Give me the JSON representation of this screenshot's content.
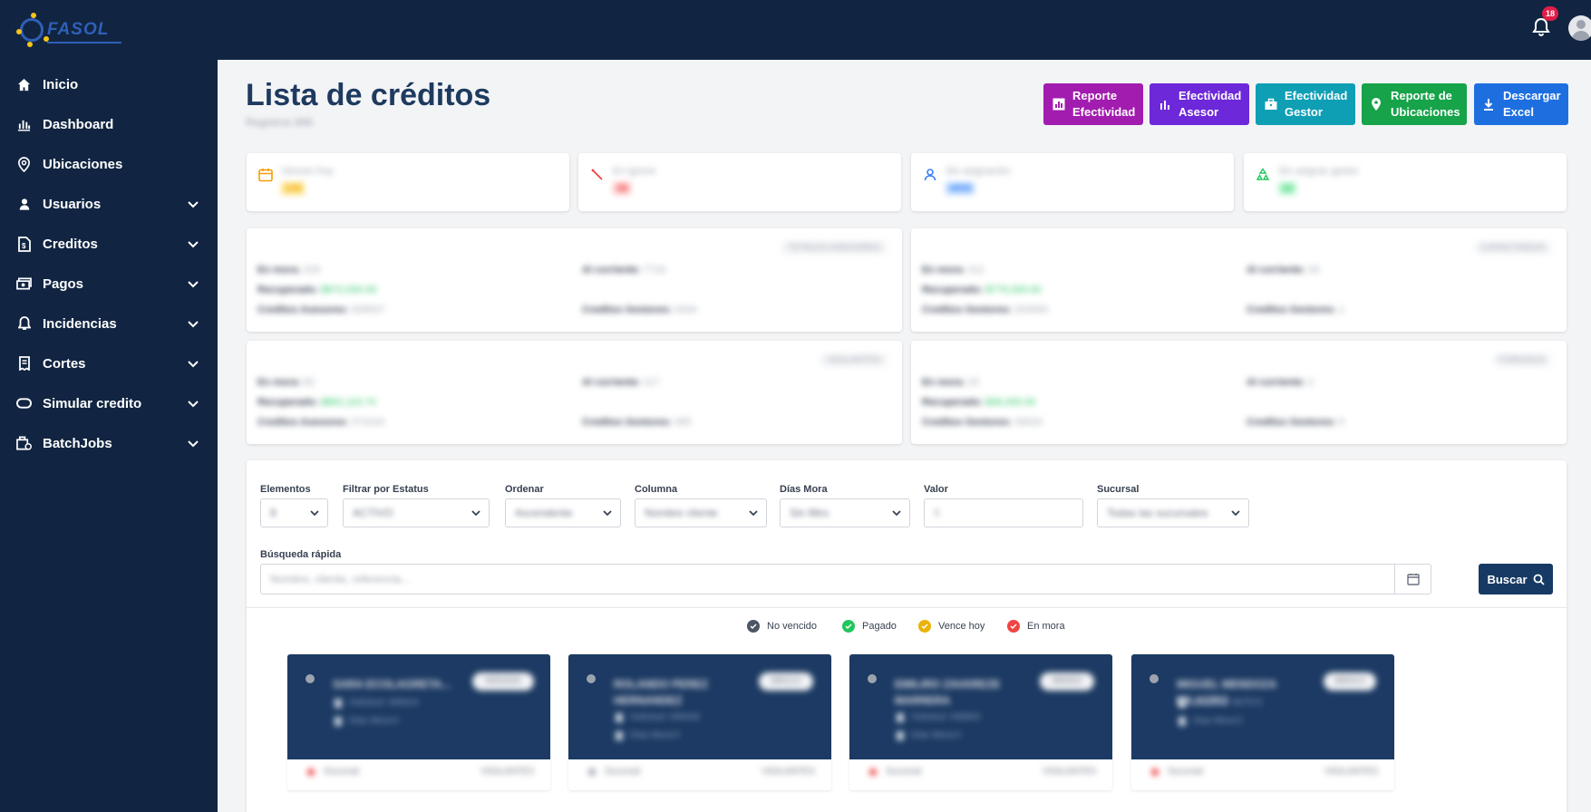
{
  "app": {
    "logo_text": "FASOL",
    "notifications_count": "18"
  },
  "sidebar": {
    "items": [
      {
        "label": "Inicio",
        "icon": "home-icon"
      },
      {
        "label": "Dashboard",
        "icon": "bar-chart-icon"
      },
      {
        "label": "Ubicaciones",
        "icon": "location-pin-icon"
      },
      {
        "label": "Usuarios",
        "icon": "user-icon"
      },
      {
        "label": "Creditos",
        "icon": "document-icon"
      },
      {
        "label": "Pagos",
        "icon": "money-icon"
      },
      {
        "label": "Incidencias",
        "icon": "bell-icon"
      },
      {
        "label": "Cortes",
        "icon": "receipt-icon"
      },
      {
        "label": "Simular credito",
        "icon": "capsule-icon"
      },
      {
        "label": "BatchJobs",
        "icon": "jobs-icon"
      }
    ]
  },
  "header": {
    "title": "Lista de créditos",
    "subtitle": "Registros 866",
    "buttons": [
      {
        "line1": "Reporte",
        "line2": "Efectividad",
        "color": "#a21caf"
      },
      {
        "line1": "Efectividad",
        "line2": "Asesor",
        "color": "#6d28d9"
      },
      {
        "line1": "Efectividad",
        "line2": "Gestor",
        "color": "#0e9fb5"
      },
      {
        "line1": "Reporte de",
        "line2": "Ubicaciones",
        "color": "#16a34a"
      },
      {
        "line1": "Descargar",
        "line2": "Excel",
        "color": "#1d6fe0"
      }
    ]
  },
  "stats": [
    {
      "label": "Vencen hoy",
      "value": "128",
      "color": "#f59e0b"
    },
    {
      "label": "En ignore",
      "value": "38",
      "color": "#ef4444"
    },
    {
      "label": "Sin asignación",
      "value": "4850",
      "color": "#3b82f6"
    },
    {
      "label": "Sin asignar gestor",
      "value": "12",
      "color": "#22c55e"
    }
  ],
  "summaries": [
    {
      "tag": "TOTALES ASESORES",
      "mora_label": "En mora:",
      "mora": "229",
      "rec_label": "Recuperado:",
      "rec": "$972,000.00",
      "ca_label": "Creditos Asesores:",
      "ca": "309537",
      "cur_label": "Al corriente:",
      "cur": "7716",
      "cg_label": "Creditos Gestores:",
      "cg": "4334"
    },
    {
      "tag": "CAPACITADOS",
      "mora_label": "En mora:",
      "mora": "112",
      "rec_label": "Recuperado:",
      "rec": "$779,300.00",
      "ca_label": "Creditos Gestores:",
      "ca": "202563",
      "cur_label": "Al corriente:",
      "cur": "33",
      "cg_label": "Creditos Gestores:",
      "cg": "1"
    },
    {
      "tag": "VIGILANTES",
      "mora_label": "En mora:",
      "mora": "82",
      "rec_label": "Recuperado:",
      "rec": "$862,115.74",
      "ca_label": "Creditos Asesores:",
      "ca": "371024",
      "cur_label": "Al corriente:",
      "cur": "117",
      "cg_label": "Creditos Gestores:",
      "cg": "465"
    },
    {
      "tag": "FOROSOS",
      "mora_label": "En mora:",
      "mora": "23",
      "rec_label": "Recuperado:",
      "rec": "$36,000.00",
      "ca_label": "Creditos Gestores:",
      "ca": "33024",
      "cur_label": "Al corriente:",
      "cur": "2",
      "cg_label": "Creditos Gestores:",
      "cg": "5"
    }
  ],
  "filters": {
    "elementos": {
      "label": "Elementos",
      "value": "8"
    },
    "estatus": {
      "label": "Filtrar por Estatus",
      "value": "ACTIVO"
    },
    "ordenar": {
      "label": "Ordenar",
      "value": "Ascendente"
    },
    "columna": {
      "label": "Columna",
      "value": "Nombre cliente"
    },
    "dias_mora": {
      "label": "Días Mora",
      "value": "Sin filtro"
    },
    "valor": {
      "label": "Valor",
      "placeholder": "0"
    },
    "sucursal": {
      "label": "Sucursal",
      "value": "Todas las sucursales"
    },
    "busqueda": {
      "label": "Búsqueda rápida",
      "placeholder": "Nombre, cliente, referencia..."
    },
    "search_button": "Buscar"
  },
  "legend": [
    {
      "label": "No vencido",
      "color": "#4b5563"
    },
    {
      "label": "Pagado",
      "color": "#22c55e"
    },
    {
      "label": "Vence hoy",
      "color": "#eab308"
    },
    {
      "label": "En mora",
      "color": "#ef4444"
    }
  ],
  "credits": [
    {
      "name": "SARA ECOLAGRETA...",
      "pill": "8063294",
      "l1": "Solicitud: 938424",
      "l2": "Días Mora:0",
      "foot_l": "Sucursal",
      "foot_r": "VIGILANTES"
    },
    {
      "name": "ROLANDO PEREZ HERNANDEZ",
      "pill": "886114",
      "l1": "Solicitud: 939446",
      "l2": "Días Mora:0",
      "foot_l": "Sucursal",
      "foot_r": "VIGILANTES"
    },
    {
      "name": "EMILIRO ZAVAREZE MARRERA",
      "pill": "989002",
      "l1": "Solicitud: 938902",
      "l2": "Días Mora:0",
      "foot_l": "Sucursal",
      "foot_r": "VIGILANTES"
    },
    {
      "name": "MIGUEL MENDOZA MILAGRO",
      "pill": "889414",
      "l1": "Solicitud: 967572",
      "l2": "Días Mora:0",
      "foot_l": "Sucursal",
      "foot_r": "VIGILANTES"
    }
  ]
}
